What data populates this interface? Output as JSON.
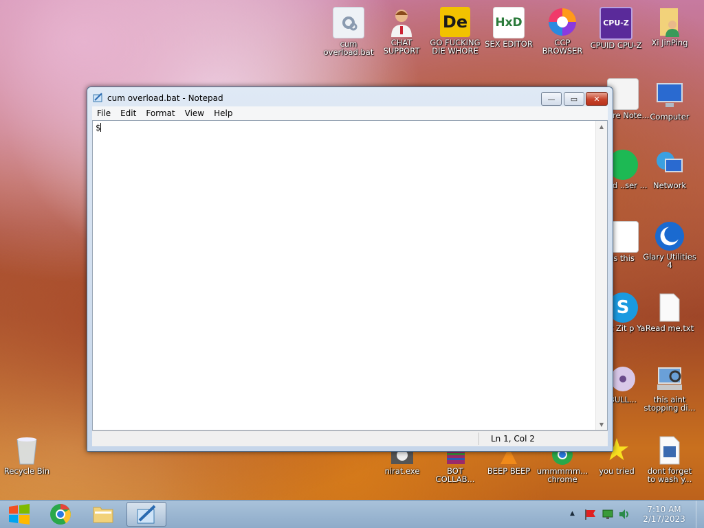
{
  "desktop": {
    "top_row": [
      {
        "label": "cum overload.bat",
        "icon": "gear-batch-file-icon"
      },
      {
        "label": "CHAT SUPPORT",
        "icon": "support-person-icon"
      },
      {
        "label": "GO FUCKING DIE WHORE",
        "icon": "de-app-icon",
        "glyph": "De"
      },
      {
        "label": "SEX EDITOR",
        "icon": "hxd-editor-icon",
        "glyph": "HxD"
      },
      {
        "label": "CCP BROWSER",
        "icon": "browser-icon"
      },
      {
        "label": "CPUID CPU-Z",
        "icon": "cpu-z-icon",
        "glyph": "CPU-Z"
      },
      {
        "label": "Xi JinPing",
        "icon": "user-folder-icon"
      }
    ],
    "right_column": [
      {
        "label": "Computer",
        "icon": "computer-icon"
      },
      {
        "label": "Network",
        "icon": "network-icon"
      },
      {
        "label": "Glary Utilities 4",
        "icon": "glary-utilities-icon"
      },
      {
        "label": "Read me.txt",
        "icon": "text-file-icon"
      },
      {
        "label": "this aint stopping di...",
        "icon": "setup-icon"
      },
      {
        "label": "dont forget to wash y...",
        "icon": "calendar-file-icon"
      }
    ],
    "partial_column": [
      {
        "label": "eware Note...",
        "icon": "document-icon"
      },
      {
        "label": "..sed ..ser ...",
        "icon": "spotify-icon"
      },
      {
        "label": "is this",
        "icon": "calendar-file-icon"
      },
      {
        "label": "hat Zit p Ya",
        "icon": "skype-icon"
      },
      {
        "label": "BULL...",
        "icon": "disc-icon"
      }
    ],
    "bottom_row": [
      {
        "label": "Recycle Bin",
        "icon": "recycle-bin-icon"
      },
      {
        "label": "nirat.exe",
        "icon": "skull-exe-icon"
      },
      {
        "label": "BOT COLLAB...",
        "icon": "winrar-icon"
      },
      {
        "label": "BEEP BEEP",
        "icon": "vlc-icon"
      },
      {
        "label": "ummmmm... chrome",
        "icon": "chrome-icon"
      },
      {
        "label": "you tried",
        "icon": "star-icon"
      }
    ]
  },
  "notepad": {
    "title": "cum overload.bat - Notepad",
    "menu": [
      "File",
      "Edit",
      "Format",
      "View",
      "Help"
    ],
    "content": "$",
    "status": "Ln 1, Col 2",
    "buttons": {
      "minimize": "—",
      "maximize": "▭",
      "close": "✕"
    }
  },
  "taskbar": {
    "clock_time": "7:10 AM",
    "clock_date": "2/17/2023",
    "tray_arrow": "▲"
  }
}
